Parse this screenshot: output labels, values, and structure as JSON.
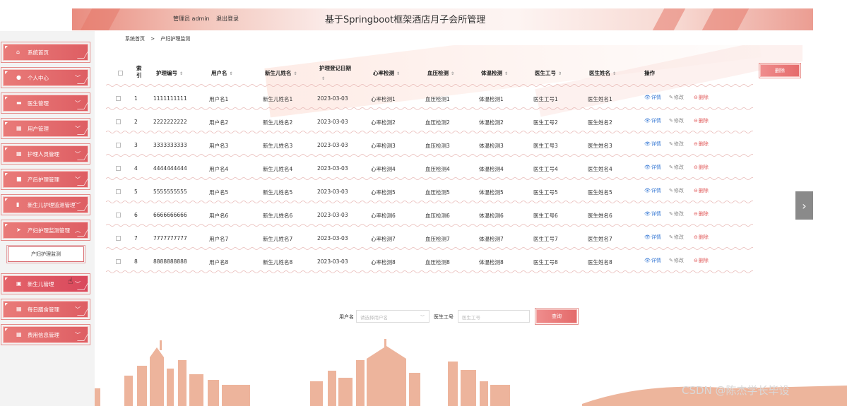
{
  "header": {
    "admin_text": "管理员 admin",
    "logout_text": "退出登录",
    "title": "基于Springboot框架酒店月子会所管理"
  },
  "breadcrumb": {
    "home": "系统首页",
    "separator": ">",
    "current": "产妇护理监测"
  },
  "sidebar": {
    "items": [
      {
        "icon": "home-icon",
        "label": "系统首页"
      },
      {
        "icon": "user-icon",
        "label": "个人中心"
      },
      {
        "icon": "card-icon",
        "label": "医生管理"
      },
      {
        "icon": "grid-icon",
        "label": "用户管理"
      },
      {
        "icon": "grid-icon",
        "label": "护理人员管理"
      },
      {
        "icon": "square-icon",
        "label": "产后护理管理"
      },
      {
        "icon": "bar-chart-icon",
        "label": "新生儿护理监测管理"
      },
      {
        "icon": "send-icon",
        "label": "产妇护理监测管理"
      },
      {
        "icon": "folder-icon",
        "label": "新生儿管理"
      },
      {
        "icon": "grid-icon",
        "label": "每日膳食管理"
      },
      {
        "icon": "grid-icon",
        "label": "费用信息管理"
      }
    ],
    "submenu_label": "产妇护理监测",
    "cursor_icon": "hand-pointer-icon"
  },
  "table": {
    "headers": {
      "index": "索引",
      "nursing_no": "护理编号",
      "username": "用户名",
      "baby_name": "新生儿姓名",
      "reg_date": "护理登记日期",
      "heart": "心率检测",
      "bp": "血压检测",
      "temp": "体温检测",
      "doctor_no": "医生工号",
      "doctor_name": "医生姓名",
      "ops": "操作"
    },
    "sort_glyph": "⇕",
    "rows": [
      {
        "index": "1",
        "nursing_no": "1111111111",
        "username": "用户名1",
        "baby_name": "新生儿姓名1",
        "reg_date": "2023-03-03",
        "heart": "心率检测1",
        "bp": "血压检测1",
        "temp": "体温检测1",
        "doctor_no": "医生工号1",
        "doctor_name": "医生姓名1"
      },
      {
        "index": "2",
        "nursing_no": "2222222222",
        "username": "用户名2",
        "baby_name": "新生儿姓名2",
        "reg_date": "2023-03-03",
        "heart": "心率检测2",
        "bp": "血压检测2",
        "temp": "体温检测2",
        "doctor_no": "医生工号2",
        "doctor_name": "医生姓名2"
      },
      {
        "index": "3",
        "nursing_no": "3333333333",
        "username": "用户名3",
        "baby_name": "新生儿姓名3",
        "reg_date": "2023-03-03",
        "heart": "心率检测3",
        "bp": "血压检测3",
        "temp": "体温检测3",
        "doctor_no": "医生工号3",
        "doctor_name": "医生姓名3"
      },
      {
        "index": "4",
        "nursing_no": "4444444444",
        "username": "用户名4",
        "baby_name": "新生儿姓名4",
        "reg_date": "2023-03-03",
        "heart": "心率检测4",
        "bp": "血压检测4",
        "temp": "体温检测4",
        "doctor_no": "医生工号4",
        "doctor_name": "医生姓名4"
      },
      {
        "index": "5",
        "nursing_no": "5555555555",
        "username": "用户名5",
        "baby_name": "新生儿姓名5",
        "reg_date": "2023-03-03",
        "heart": "心率检测5",
        "bp": "血压检测5",
        "temp": "体温检测5",
        "doctor_no": "医生工号5",
        "doctor_name": "医生姓名5"
      },
      {
        "index": "6",
        "nursing_no": "6666666666",
        "username": "用户名6",
        "baby_name": "新生儿姓名6",
        "reg_date": "2023-03-03",
        "heart": "心率检测6",
        "bp": "血压检测6",
        "temp": "体温检测6",
        "doctor_no": "医生工号6",
        "doctor_name": "医生姓名6"
      },
      {
        "index": "7",
        "nursing_no": "7777777777",
        "username": "用户名7",
        "baby_name": "新生儿姓名7",
        "reg_date": "2023-03-03",
        "heart": "心率检测7",
        "bp": "血压检测7",
        "temp": "体温检测7",
        "doctor_no": "医生工号7",
        "doctor_name": "医生姓名7"
      },
      {
        "index": "8",
        "nursing_no": "8888888888",
        "username": "用户名8",
        "baby_name": "新生儿姓名8",
        "reg_date": "2023-03-03",
        "heart": "心率检测8",
        "bp": "血压检测8",
        "temp": "体温检测8",
        "doctor_no": "医生工号8",
        "doctor_name": "医生姓名8"
      }
    ],
    "actions": {
      "detail": "详情",
      "edit": "修改",
      "delete": "删除"
    }
  },
  "batch_delete_label": "删除",
  "search": {
    "username_label": "用户名",
    "username_placeholder": "请选择用户名",
    "doctor_no_label": "医生工号",
    "doctor_no_placeholder": "医生工号",
    "search_button": "查询"
  },
  "next_arrow": "›",
  "watermark": "CSDN @陈杰学长毕设",
  "colors": {
    "accent": "#e0636a",
    "detail": "#3a7bd5",
    "delete": "#e05858"
  }
}
